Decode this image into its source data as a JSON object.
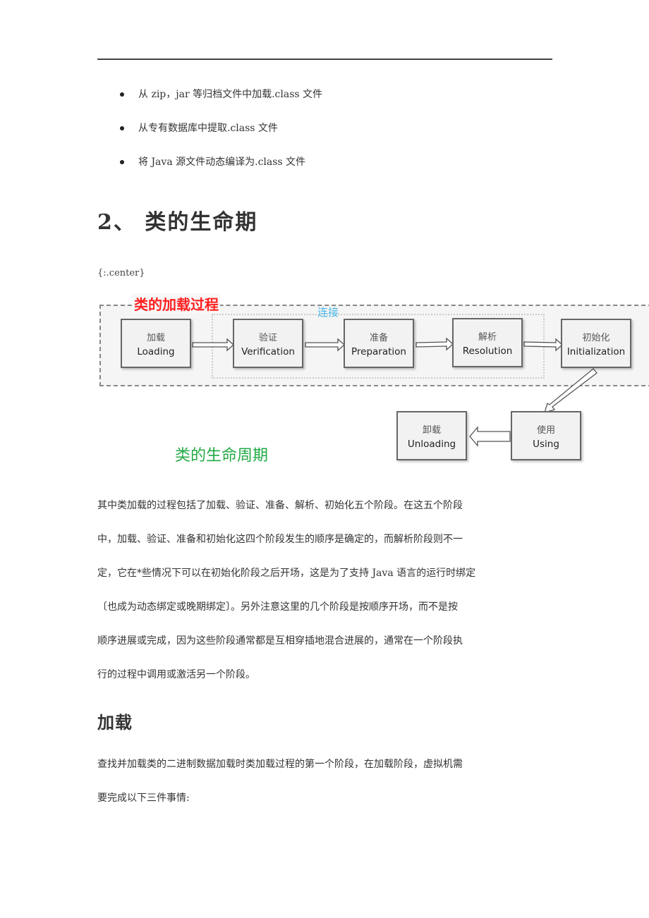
{
  "bullets": [
    "从 zip，jar 等归档文件中加载.class 文件",
    "从专有数据库中提取.class 文件",
    "将 Java 源文件动态编译为.class 文件"
  ],
  "section_heading": "2、 类的生命期",
  "center_tag": "{:.center}",
  "diagram": {
    "loading_process_label": "类的加载过程",
    "linking_label": "连接",
    "lifecycle_label": "类的生命周期",
    "stages": [
      {
        "cn": "加载",
        "en": "Loading"
      },
      {
        "cn": "验证",
        "en": "Verification"
      },
      {
        "cn": "准备",
        "en": "Preparation"
      },
      {
        "cn": "解析",
        "en": "Resolution"
      },
      {
        "cn": "初始化",
        "en": "Initialization"
      },
      {
        "cn": "使用",
        "en": "Using"
      },
      {
        "cn": "卸载",
        "en": "Unloading"
      }
    ],
    "colors": {
      "loading_label": "#ff2020",
      "linking_label": "#4ab8e8",
      "lifecycle_label": "#22aa44"
    }
  },
  "paragraph1_lines": [
    "其中类加载的过程包括了加载、验证、准备、解析、初始化五个阶段。在这五个阶段",
    "中，加载、验证、准备和初始化这四个阶段发生的顺序是确定的，而解析阶段则不一",
    "定，它在*些情况下可以在初始化阶段之后开场，这是为了支持 Java 语言的运行时绑定",
    "〔也成为动态绑定或晚期绑定〕。另外注意这里的几个阶段是按顺序开场，而不是按",
    "顺序进展或完成，因为这些阶段通常都是互相穿插地混合进展的，通常在一个阶段执",
    "行的过程中调用或激活另一个阶段。"
  ],
  "subheading": "加载",
  "paragraph2_lines": [
    "查找并加载类的二进制数据加载时类加载过程的第一个阶段，在加载阶段，虚拟机需",
    "要完成以下三件事情:"
  ]
}
